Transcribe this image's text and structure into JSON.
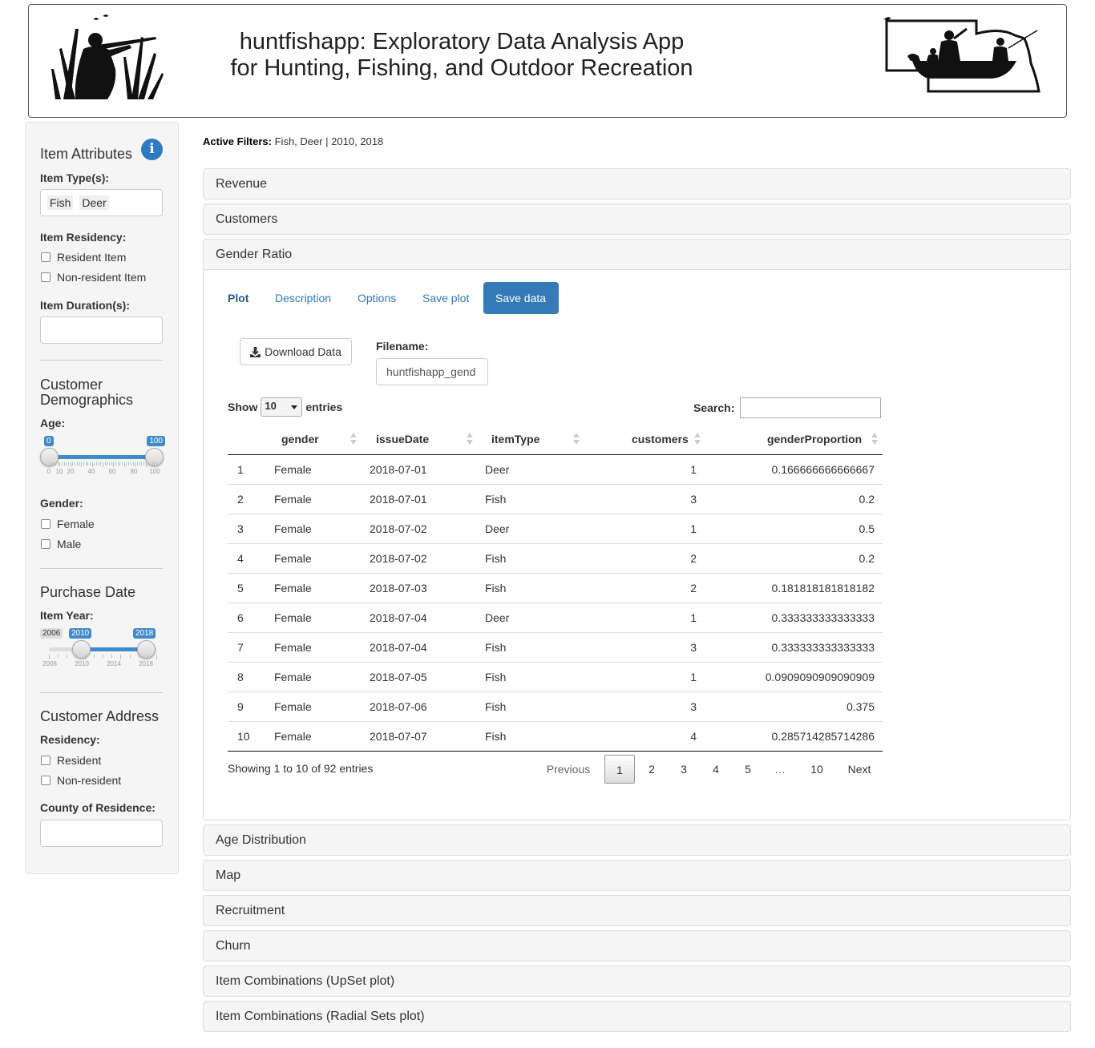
{
  "header": {
    "title_line1": "huntfishapp: Exploratory Data Analysis App",
    "title_line2": "for Hunting, Fishing, and Outdoor Recreation"
  },
  "sidebar": {
    "item_attributes": {
      "heading": "Item Attributes",
      "info_icon": "i",
      "item_types_label": "Item Type(s):",
      "item_types_selected": [
        "Fish",
        "Deer"
      ],
      "residency_label": "Item Residency:",
      "residency_options": [
        "Resident Item",
        "Non-resident Item"
      ],
      "duration_label": "Item Duration(s):",
      "duration_value": ""
    },
    "customer_demographics": {
      "heading": "Customer Demographics",
      "age_label": "Age:",
      "age_min": "0",
      "age_max": "100",
      "age_range": [
        0,
        100
      ],
      "age_ticks": [
        "0",
        "10",
        "20",
        "40",
        "60",
        "80",
        "100"
      ],
      "gender_label": "Gender:",
      "gender_options": [
        "Female",
        "Male"
      ]
    },
    "purchase_date": {
      "heading": "Purchase Date",
      "item_year_label": "Item Year:",
      "year_min": "2006",
      "year_from": "2010",
      "year_to": "2018",
      "year_range": [
        2010,
        2018
      ],
      "year_ticks": [
        "2006",
        "2010",
        "2014",
        "2018"
      ]
    },
    "customer_address": {
      "heading": "Customer Address",
      "residency_label": "Residency:",
      "residency_options": [
        "Resident",
        "Non-resident"
      ],
      "county_label": "County of Residence:",
      "county_value": ""
    }
  },
  "main": {
    "active_filters_label": "Active Filters:",
    "active_filters_value": "Fish, Deer | 2010, 2018",
    "panels_before": [
      "Revenue",
      "Customers"
    ],
    "open_panel": "Gender Ratio",
    "panels_after": [
      "Age Distribution",
      "Map",
      "Recruitment",
      "Churn",
      "Item Combinations (UpSet plot)",
      "Item Combinations (Radial Sets plot)"
    ],
    "tabs": [
      "Plot",
      "Description",
      "Options",
      "Save plot",
      "Save data"
    ],
    "active_tab": "Save data",
    "download_button": "Download Data",
    "filename_label": "Filename:",
    "filename_value": "huntfishapp_gend",
    "show_label": "Show",
    "entries_value": "10",
    "entries_label": "entries",
    "search_label": "Search:",
    "search_value": "",
    "table": {
      "columns": [
        "",
        "gender",
        "issueDate",
        "itemType",
        "customers",
        "genderProportion"
      ],
      "rows": [
        [
          "1",
          "Female",
          "2018-07-01",
          "Deer",
          "1",
          "0.166666666666667"
        ],
        [
          "2",
          "Female",
          "2018-07-01",
          "Fish",
          "3",
          "0.2"
        ],
        [
          "3",
          "Female",
          "2018-07-02",
          "Deer",
          "1",
          "0.5"
        ],
        [
          "4",
          "Female",
          "2018-07-02",
          "Fish",
          "2",
          "0.2"
        ],
        [
          "5",
          "Female",
          "2018-07-03",
          "Fish",
          "2",
          "0.181818181818182"
        ],
        [
          "6",
          "Female",
          "2018-07-04",
          "Deer",
          "1",
          "0.333333333333333"
        ],
        [
          "7",
          "Female",
          "2018-07-04",
          "Fish",
          "3",
          "0.333333333333333"
        ],
        [
          "8",
          "Female",
          "2018-07-05",
          "Fish",
          "1",
          "0.0909090909090909"
        ],
        [
          "9",
          "Female",
          "2018-07-06",
          "Fish",
          "3",
          "0.375"
        ],
        [
          "10",
          "Female",
          "2018-07-07",
          "Fish",
          "4",
          "0.285714285714286"
        ]
      ]
    },
    "showing_info": "Showing 1 to 10 of 92 entries",
    "pagination": {
      "previous": "Previous",
      "pages": [
        "1",
        "2",
        "3",
        "4",
        "5",
        "…",
        "10"
      ],
      "current": "1",
      "next": "Next"
    }
  }
}
